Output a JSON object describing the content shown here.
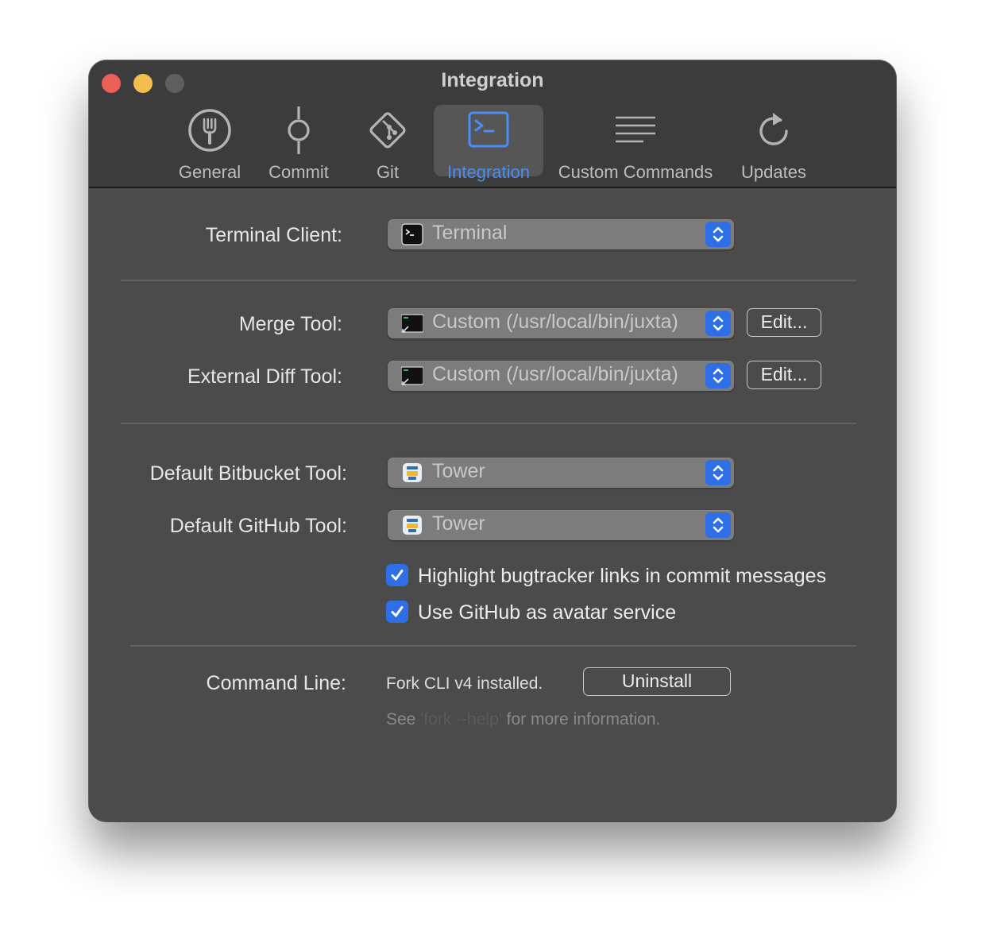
{
  "window": {
    "title": "Integration"
  },
  "toolbar": {
    "tabs": [
      {
        "label": "General",
        "icon": "fork-icon"
      },
      {
        "label": "Commit",
        "icon": "commit-icon"
      },
      {
        "label": "Git",
        "icon": "git-icon"
      },
      {
        "label": "Integration",
        "icon": "terminal-icon",
        "selected": true
      },
      {
        "label": "Custom Commands",
        "icon": "lines-icon"
      },
      {
        "label": "Updates",
        "icon": "refresh-icon"
      }
    ]
  },
  "terminal": {
    "label": "Terminal Client:",
    "value": "Terminal"
  },
  "merge": {
    "label": "Merge Tool:",
    "value": "Custom (/usr/local/bin/juxta)",
    "edit_label": "Edit..."
  },
  "diff": {
    "label": "External Diff Tool:",
    "value": "Custom (/usr/local/bin/juxta)",
    "edit_label": "Edit..."
  },
  "bitbucket": {
    "label": "Default Bitbucket Tool:",
    "value": "Tower"
  },
  "github": {
    "label": "Default GitHub Tool:",
    "value": "Tower"
  },
  "options": {
    "highlight_bugtracker": {
      "label": "Highlight bugtracker links in commit messages",
      "checked": true
    },
    "github_avatar": {
      "label": "Use GitHub as avatar service",
      "checked": true
    }
  },
  "command_line": {
    "label": "Command Line:",
    "status": "Fork CLI v4 installed.",
    "uninstall_label": "Uninstall",
    "help_prefix": "See",
    "help_command": "'fork --help'",
    "help_suffix": "for more information."
  },
  "colors": {
    "accent": "#2f6fe6",
    "selected_tab": "#4b8cf7",
    "window_bg": "#4b4b4b"
  }
}
